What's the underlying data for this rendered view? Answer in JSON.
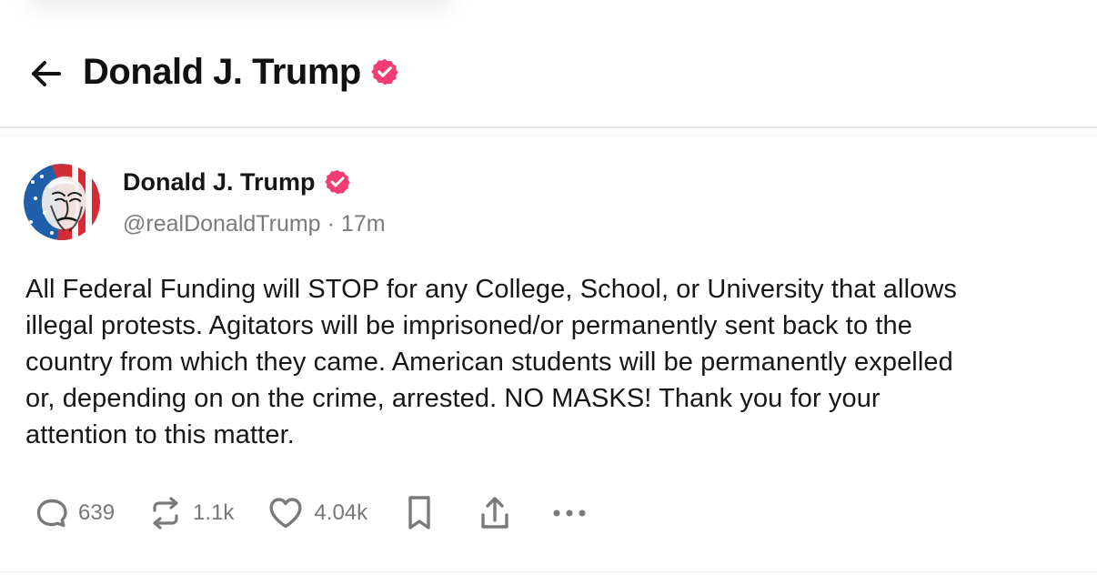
{
  "header": {
    "title": "Donald J. Trump",
    "back_icon": "arrow-left-icon",
    "verified_icon": "verified-badge-icon"
  },
  "post": {
    "author": {
      "name": "Donald J. Trump",
      "handle": "@realDonaldTrump",
      "time": "17m",
      "avatar_icon": "flag-portrait-avatar",
      "verified_icon": "verified-badge-icon"
    },
    "text": "All Federal Funding will STOP for any College, School, or University that allows\nillegal protests. Agitators will be imprisoned/or permanently sent back to the\ncountry from which they came. American students will be permanently expelled\nor, depending on on the crime, arrested. NO MASKS! Thank you for your\nattention to this matter.",
    "actions": {
      "reply_count": "639",
      "repost_count": "1.1k",
      "like_count": "4.04k",
      "reply_icon": "comment-icon",
      "repost_icon": "repost-icon",
      "like_icon": "heart-icon",
      "bookmark_icon": "bookmark-icon",
      "share_icon": "share-icon",
      "more_icon": "more-icon"
    }
  },
  "colors": {
    "verified": "#f23d72",
    "text": "#171717",
    "muted": "#7b7b7b",
    "divider": "#e6e6e6",
    "flag_red": "#d62b35",
    "flag_blue": "#1f5ea8"
  }
}
